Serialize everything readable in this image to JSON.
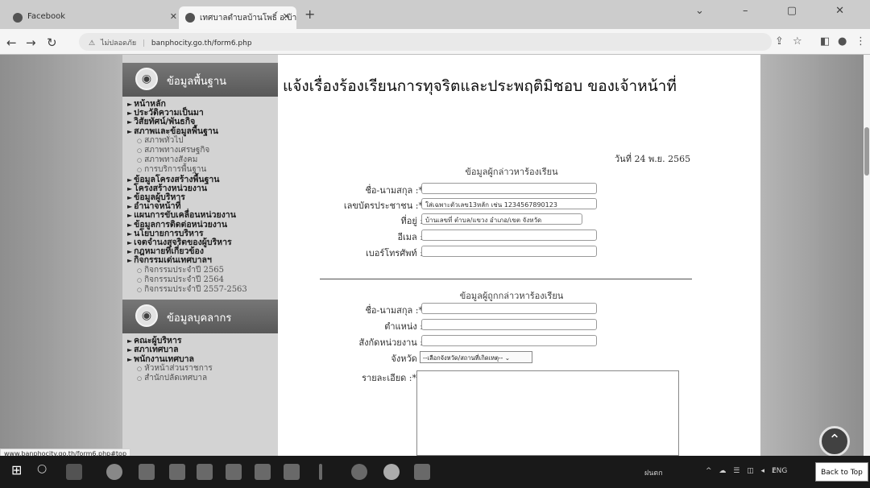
{
  "browser": {
    "tabs": [
      {
        "title": "Facebook"
      },
      {
        "title": "เทศบาลตำบลบ้านโพธิ์ อ.บ้านโพธิ์ จ.ฉะ"
      }
    ],
    "address": {
      "security_label": "ไม่ปลอดภัย",
      "url": "banphocity.go.th/form6.php"
    }
  },
  "sidebar": {
    "section1_title": "ข้อมูลพื้นฐาน",
    "section2_title": "ข้อมูลบุคลากร",
    "menu": [
      {
        "label": "หน้าหลัก",
        "type": "item"
      },
      {
        "label": "ประวัติความเป็นมา",
        "type": "item"
      },
      {
        "label": "วิสัยทัศน์/พันธกิจ",
        "type": "item"
      },
      {
        "label": "สภาพและข้อมูลพื้นฐาน",
        "type": "item"
      },
      {
        "label": "สภาพทั่วไป",
        "type": "sub"
      },
      {
        "label": "สภาพทางเศรษฐกิจ",
        "type": "sub"
      },
      {
        "label": "สภาพทางสังคม",
        "type": "sub"
      },
      {
        "label": "การบริการพื้นฐาน",
        "type": "sub"
      },
      {
        "label": "ข้อมูลโครงสร้างพื้นฐาน",
        "type": "item"
      },
      {
        "label": "โครงสร้างหน่วยงาน",
        "type": "item"
      },
      {
        "label": "ข้อมูลผู้บริหาร",
        "type": "item"
      },
      {
        "label": "อำนาจหน้าที่",
        "type": "item"
      },
      {
        "label": "แผนการขับเคลื่อนหน่วยงาน",
        "type": "item"
      },
      {
        "label": "ข้อมูลการติดต่อหน่วยงาน",
        "type": "item"
      },
      {
        "label": "นโยบายการบริหาร",
        "type": "item"
      },
      {
        "label": "เจตจำนงสุจริตของผู้บริหาร",
        "type": "item"
      },
      {
        "label": "กฎหมายที่เกี่ยวข้อง",
        "type": "item"
      },
      {
        "label": "กิจกรรมเด่นเทศบาลฯ",
        "type": "item"
      },
      {
        "label": "กิจกรรมประจำปี 2565",
        "type": "sub"
      },
      {
        "label": "กิจกรรมประจำปี 2564",
        "type": "sub"
      },
      {
        "label": "กิจกรรมประจำปี 2557-2563",
        "type": "sub"
      }
    ],
    "menu2": [
      {
        "label": "คณะผู้บริหาร",
        "type": "item"
      },
      {
        "label": "สภาเทศบาล",
        "type": "item"
      },
      {
        "label": "พนักงานเทศบาล",
        "type": "item"
      },
      {
        "label": "หัวหน้าส่วนราชการ",
        "type": "sub"
      },
      {
        "label": "สำนักปลัดเทศบาล",
        "type": "sub"
      }
    ]
  },
  "main": {
    "title": "แจ้งเรื่องร้องเรียนการทุจริตและประพฤติมิชอบ ของเจ้าหน้าที่",
    "date": "วันที่ 24 พ.ย. 2565",
    "complainant_heading": "ข้อมูลผู้กล่าวหาร้องเรียน",
    "complainant": {
      "name_label": "ชื่อ-นามสกุล :*",
      "id_label": "เลขบัตรประชาชน :*",
      "id_placeholder": "ใส่เฉพาะตัวเลข13หลัก เช่น 1234567890123",
      "address_label": "ที่อยู่ :",
      "address_placeholder": "บ้านเลขที่ ตำบล/แขวง อำเภอ/เขต จังหวัด",
      "email_label": "อีเมล :",
      "phone_label": "เบอร์โทรศัพท์ :"
    },
    "accused_heading": "ข้อมูลผู้ถูกกล่าวหาร้องเรียน",
    "accused": {
      "name_label": "ชื่อ-นามสกุล :*",
      "position_label": "ตำแหน่ง :",
      "agency_label": "สังกัดหน่วยงาน :",
      "province_label": "จังหวัด :",
      "province_selected": "--เลือกจังหวัด/สถานที่เกิดเหตุ--",
      "detail_label": "รายละเอียด :*"
    }
  },
  "status_url": "www.banphocity.go.th/form6.php#top",
  "back_to_top": "Back to Top",
  "taskbar": {
    "weather": "ฝนตก",
    "lang": "ENG"
  }
}
